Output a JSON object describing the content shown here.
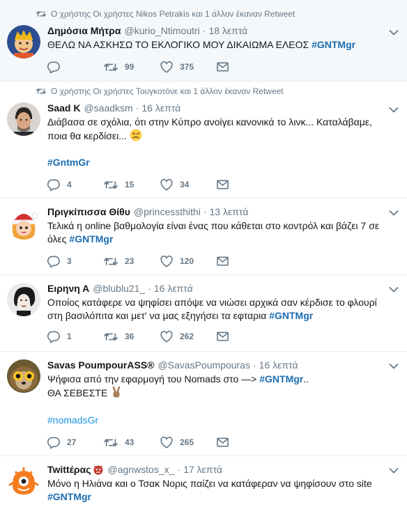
{
  "tweets": [
    {
      "retweet_text": "Ο χρήστης Οι χρήστες Nikos Petrakis και 1 άλλον έκαναν Retweet",
      "name": "Δημόσια Μήτρα",
      "handle": "@kurio_Ntimoutri",
      "time": "18 λεπτά",
      "text": "ΘΕΛΩ ΝΑ ΑΣΚΗΣΩ ΤΟ ΕΚΛΟΓΙΚΟ ΜΟΥ ΔΙΚΑΙΩΜΑ ΕΛΕΟΣ",
      "hashtag": "#GNTMgr",
      "reply_count": "",
      "retweet_count": "99",
      "like_count": "375"
    },
    {
      "retweet_text": "Ο χρήστης Οι χρήστες Τουγκοτόνε και 1 άλλον έκαναν Retweet",
      "name": "Saad K",
      "handle": "@saadksm",
      "time": "16 λεπτά",
      "text_line1": "Διάβασα σε σχόλια, ότι στην Κύπρο ανοίγει κανονικά το λινκ... Καταλάβαμε,",
      "text_line2": "ποια θα κερδίσει...",
      "hashtag": "#GntmGr",
      "reply_count": "4",
      "retweet_count": "15",
      "like_count": "34"
    },
    {
      "name": "Πριγκίπισσα Θίθυ",
      "handle": "@princessthithi",
      "time": "13 λεπτά",
      "text_line1": "Τελικά η online βαθμολογία είναι ένας που κάθεται στο κοντρόλ και βάζει 7 σε",
      "text_line2": "όλες",
      "hashtag": "#GNTMgr",
      "reply_count": "3",
      "retweet_count": "23",
      "like_count": "120"
    },
    {
      "name": "Ειρηνη Α",
      "handle": "@blublu21_",
      "time": "16 λεπτά",
      "text_line1": "Οποίος κατάφερε να ψηφίσει απόψε να νιώσει αρχικά σαν κέρδισε το φλουρί",
      "text_line2": "στη βασιλόπιτα και μετ' να μας εξηγήσει τα εφταρια",
      "hashtag": "#GNTMgr",
      "reply_count": "1",
      "retweet_count": "36",
      "like_count": "262"
    },
    {
      "name": "Savas PoumpourASS®",
      "handle": "@SavasPoumpouras",
      "time": "16 λεπτά",
      "text_line1": "Ψήφισα από την εφαρμογή του Nomads στο —>",
      "hashtag": "#GNTMgr",
      "text_line1_end": "..",
      "text_line2": "ΘΑ ΣΕΒΕΣΤΕ",
      "hashtag2": "#nomadsGr",
      "reply_count": "27",
      "retweet_count": "43",
      "like_count": "265"
    },
    {
      "name": "Twittέρας",
      "handle": "@agnwstos_x_",
      "time": "17 λεπτά",
      "text_line1": "Μόνο η Ηλιάνα και ο Τσακ Νορις παίζει να κατάφεραν να ψηφίσουν στο site",
      "hashtag": "#GNTMgr"
    }
  ]
}
